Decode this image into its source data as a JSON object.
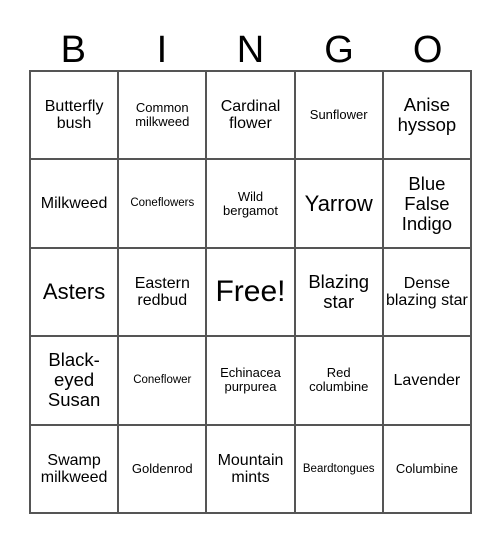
{
  "card": {
    "title_letters": [
      "B",
      "I",
      "N",
      "G",
      "O"
    ],
    "columns": 5,
    "rows": 5,
    "free_space_label": "Free!",
    "border_color": "#555555",
    "background_color": "#ffffff",
    "text_color": "#000000",
    "cells": [
      [
        {
          "label": "Butterfly bush",
          "size": "md"
        },
        {
          "label": "Common milkweed",
          "size": "sm"
        },
        {
          "label": "Cardinal flower",
          "size": "md"
        },
        {
          "label": "Sunflower",
          "size": "sm"
        },
        {
          "label": "Anise hyssop",
          "size": "lg"
        }
      ],
      [
        {
          "label": "Milkweed",
          "size": "md"
        },
        {
          "label": "Coneflowers",
          "size": "xs"
        },
        {
          "label": "Wild bergamot",
          "size": "sm"
        },
        {
          "label": "Yarrow",
          "size": "xl"
        },
        {
          "label": "Blue False Indigo",
          "size": "lg"
        }
      ],
      [
        {
          "label": "Asters",
          "size": "xl"
        },
        {
          "label": "Eastern redbud",
          "size": "md"
        },
        {
          "label": "Free!",
          "size": "free"
        },
        {
          "label": "Blazing star",
          "size": "lg"
        },
        {
          "label": "Dense blazing star",
          "size": "md"
        }
      ],
      [
        {
          "label": "Black- eyed Susan",
          "size": "lg"
        },
        {
          "label": "Coneflower",
          "size": "xs"
        },
        {
          "label": "Echinacea purpurea",
          "size": "sm"
        },
        {
          "label": "Red columbine",
          "size": "sm"
        },
        {
          "label": "Lavender",
          "size": "md"
        }
      ],
      [
        {
          "label": "Swamp milkweed",
          "size": "md"
        },
        {
          "label": "Goldenrod",
          "size": "sm"
        },
        {
          "label": "Mountain mints",
          "size": "md"
        },
        {
          "label": "Beardtongues",
          "size": "xs"
        },
        {
          "label": "Columbine",
          "size": "sm"
        }
      ]
    ]
  }
}
